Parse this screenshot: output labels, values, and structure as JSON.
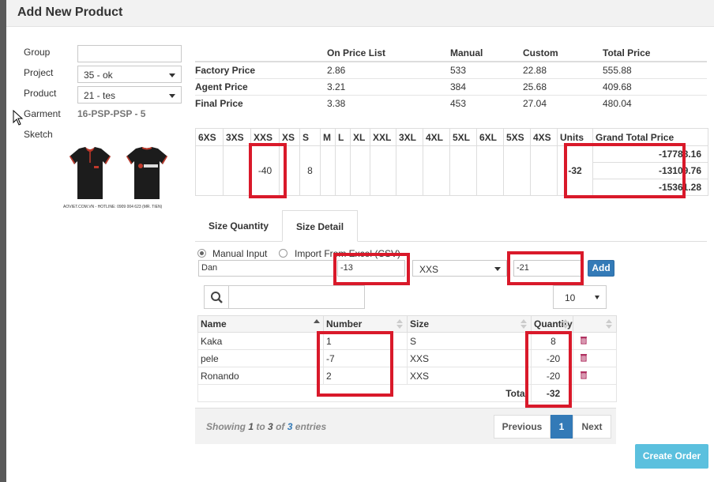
{
  "modal": {
    "title": "Add New Product"
  },
  "form": {
    "group_label": "Group",
    "group_value": "",
    "project_label": "Project",
    "project_value": "35 - ok",
    "product_label": "Product",
    "product_value": "21 - tes",
    "garment_label": "Garment",
    "garment_value": "16-PSP-PSP - 5",
    "sketch_label": "Sketch",
    "sketch_caption": "AOVIET.COM.VN - HOTLINE: 0909 004 623 (MR. TIEN)"
  },
  "price_table": {
    "headers": [
      "",
      "On Price List",
      "Manual",
      "Custom",
      "Total Price"
    ],
    "rows": [
      [
        "Factory Price",
        "2.86",
        "533",
        "22.88",
        "555.88"
      ],
      [
        "Agent Price",
        "3.21",
        "384",
        "25.68",
        "409.68"
      ],
      [
        "Final Price",
        "3.38",
        "453",
        "27.04",
        "480.04"
      ]
    ]
  },
  "size_table": {
    "headers": [
      "6XS",
      "3XS",
      "XXS",
      "XS",
      "S",
      "M",
      "L",
      "XL",
      "XXL",
      "3XL",
      "4XL",
      "5XL",
      "6XL",
      "5XS",
      "4XS",
      "Units",
      "Grand Total Price"
    ],
    "values": [
      "",
      "",
      "-40",
      "",
      "8",
      "",
      "",
      "",
      "",
      "",
      "",
      "",
      "",
      "",
      "",
      "-32"
    ],
    "grand_totals": [
      "-17788.16",
      "-13109.76",
      "-15361.28"
    ]
  },
  "tabs": [
    "Size Quantity",
    "Size Detail"
  ],
  "input_mode": {
    "manual": "Manual Input",
    "import": "Import From Excel (CSV)"
  },
  "entry": {
    "name": "Dan",
    "number": "-13",
    "size": "XXS",
    "quantity": "-21",
    "add_label": "Add"
  },
  "search": {
    "value": ""
  },
  "page_length": "10",
  "data_table": {
    "headers": [
      "Name",
      "Number",
      "Size",
      "Quantity",
      ""
    ],
    "rows": [
      {
        "name": "Kaka",
        "number": "1",
        "size": "S",
        "quantity": "8"
      },
      {
        "name": "pele",
        "number": "-7",
        "size": "XXS",
        "quantity": "-20"
      },
      {
        "name": "Ronando",
        "number": "2",
        "size": "XXS",
        "quantity": "-20"
      }
    ],
    "total_label": "Total",
    "total_value": "-32"
  },
  "pagination": {
    "showing": "Showing",
    "from": "1",
    "to_word": "to",
    "to": "3",
    "of_word": "of",
    "total": "3",
    "entries": "entries",
    "previous": "Previous",
    "page": "1",
    "next": "Next"
  },
  "create_label": "Create Order",
  "colors": {
    "primary": "#337ab7",
    "info": "#5bc0de",
    "highlight": "#d9192a"
  }
}
